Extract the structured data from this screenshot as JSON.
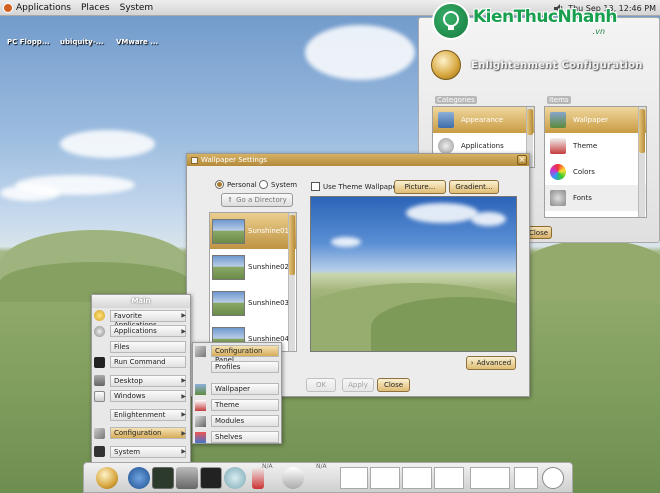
{
  "top_panel": {
    "menus": [
      "Applications",
      "Places",
      "System"
    ],
    "clock": "Thu Sep 13, 12:46 PM"
  },
  "watermark": {
    "title": "KienThucNhanh",
    "url": ".vn"
  },
  "desktop_icons": [
    "PC Flopp...",
    "ubiquity-...",
    "VMware ..."
  ],
  "enl_config": {
    "title": "Enlightenment Configuration",
    "categories_label": "Categories",
    "items_label": "Items",
    "categories": [
      {
        "label": "Appearance",
        "selected": true
      },
      {
        "label": "Applications",
        "selected": false
      }
    ],
    "items": [
      {
        "label": "Wallpaper",
        "selected": true
      },
      {
        "label": "Theme",
        "selected": false
      },
      {
        "label": "Colors",
        "selected": false
      },
      {
        "label": "Fonts",
        "selected": false
      }
    ],
    "close_label": "Close"
  },
  "wallpaper_settings": {
    "title": "Wallpaper Settings",
    "personal_label": "Personal",
    "system_label": "System",
    "go_up_label": "Go a Directory",
    "use_theme_label": "Use Theme Wallpaper",
    "picture_label": "Picture...",
    "gradient_label": "Gradient...",
    "advanced_label": "Advanced",
    "ok_label": "OK",
    "apply_label": "Apply",
    "close_label": "Close",
    "wallpapers": [
      {
        "label": "Sunshine01",
        "selected": true
      },
      {
        "label": "Sunshine02",
        "selected": false
      },
      {
        "label": "Sunshine03",
        "selected": false
      },
      {
        "label": "Sunshine04",
        "selected": false
      }
    ]
  },
  "main_menu": {
    "title": "Main",
    "items": [
      {
        "label": "Favorite Applications",
        "arrow": true
      },
      {
        "label": "Applications",
        "arrow": true
      },
      {
        "label": "Files",
        "arrow": false
      },
      {
        "label": "Run Command",
        "arrow": false
      },
      {
        "label": "Desktop",
        "arrow": true
      },
      {
        "label": "Windows",
        "arrow": true
      },
      {
        "label": "Enlightenment",
        "arrow": true
      },
      {
        "label": "Configuration",
        "arrow": true
      },
      {
        "label": "System",
        "arrow": true
      }
    ]
  },
  "sub_menu": {
    "items": [
      "Configuration Panel",
      "Profiles",
      "Wallpaper",
      "Theme",
      "Modules",
      "Shelves"
    ]
  },
  "shelf": {
    "battery_label": "N/A",
    "temp_label": "N/A"
  }
}
